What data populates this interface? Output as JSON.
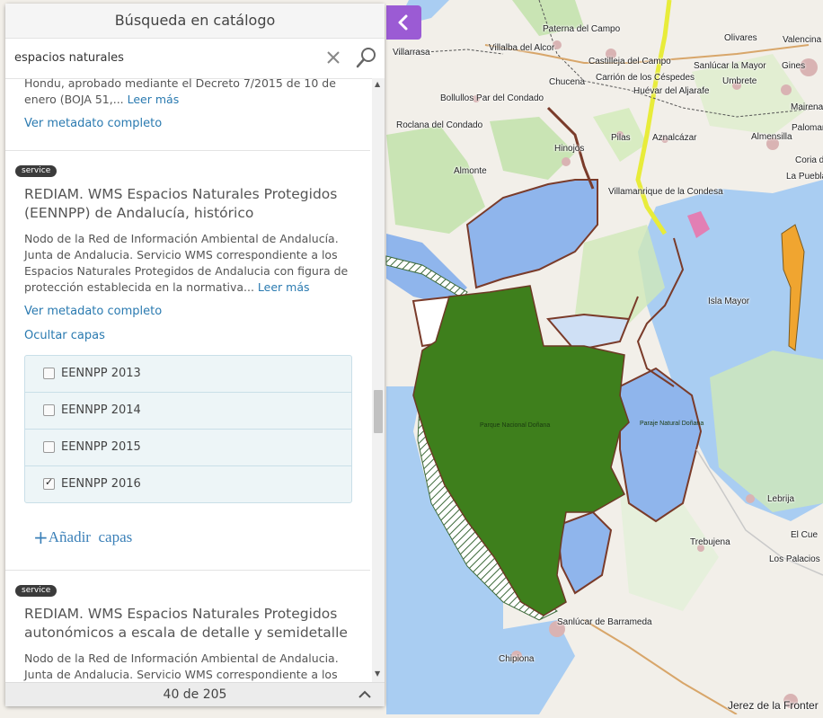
{
  "panel": {
    "title": "Búsqueda en catálogo",
    "search": {
      "value": "espacios naturales",
      "placeholder": ""
    },
    "footer": {
      "count": "40 de 205"
    }
  },
  "results": [
    {
      "partial": true,
      "description_lines": [
        "Hondu, aprobado mediante el Decreto 7/2015 de 10 de",
        "enero (BOJA 51,... "
      ],
      "read_more": "Leer más",
      "metadata_link": "Ver metadato completo"
    },
    {
      "badge": "service",
      "title": "REDIAM. WMS Espacios Naturales Protegidos (EENNPP) de Andalucía, histórico",
      "description": "Nodo de la Red de Información Ambiental de Andalucía. Junta de Andalucia. Servicio WMS correspondiente a los Espacios Naturales Protegidos de Andalucia con figura de protección establecida en la normativa... ",
      "read_more": "Leer más",
      "metadata_link": "Ver metadato completo",
      "hide_layers": "Ocultar capas",
      "layers": [
        {
          "label": "EENNPP 2013",
          "checked": false
        },
        {
          "label": "EENNPP 2014",
          "checked": false
        },
        {
          "label": "EENNPP 2015",
          "checked": false
        },
        {
          "label": "EENNPP 2016",
          "checked": true
        }
      ],
      "add_layers": "Añadir  capas"
    },
    {
      "badge": "service",
      "title": "REDIAM. WMS Espacios Naturales Protegidos autonómicos a escala de detalle y semidetalle",
      "description": "Nodo de la Red de Información Ambiental de Andalucia. Junta de Andalucia. Servicio WMS correspondiente a los Espacios Naturales Protegidos de Andalucia con figura de"
    }
  ],
  "map": {
    "colors": {
      "sea": "#a9cdf2",
      "land": "#f2efe9",
      "protected": "#3e7f1c",
      "marsh": "#90b9ec",
      "accent": "#9b5bd4"
    },
    "places": [
      {
        "name": "Paterna del Campo"
      },
      {
        "name": "Olivares"
      },
      {
        "name": "Valencina"
      },
      {
        "name": "Villarrasa"
      },
      {
        "name": "Villalba del Alcor"
      },
      {
        "name": "Castilleja del Campo"
      },
      {
        "name": "Sanlúcar la Mayor"
      },
      {
        "name": "Gines"
      },
      {
        "name": "Chucena"
      },
      {
        "name": "Carrión de los Céspedes"
      },
      {
        "name": "Umbrete"
      },
      {
        "name": "Huévar del Aljarafe"
      },
      {
        "name": "Bollullos Par del Condado"
      },
      {
        "name": "Mairena"
      },
      {
        "name": "Roclana del Condado"
      },
      {
        "name": "Pilas"
      },
      {
        "name": "Aznalcázar"
      },
      {
        "name": "Almensilla"
      },
      {
        "name": "Palomar"
      },
      {
        "name": "Hinojos"
      },
      {
        "name": "Coria d"
      },
      {
        "name": "Almonte"
      },
      {
        "name": "La Puebla"
      },
      {
        "name": "Villamanrique de la Condesa"
      },
      {
        "name": "Isla Mayor"
      },
      {
        "name": "Parque Nacional Doñana"
      },
      {
        "name": "Paraje Natural Doñana"
      },
      {
        "name": "Lebrija"
      },
      {
        "name": "El Cue"
      },
      {
        "name": "Trebujena"
      },
      {
        "name": "Los Palacios"
      },
      {
        "name": "Sanlúcar de Barrameda"
      },
      {
        "name": "Chipiona"
      },
      {
        "name": "Jerez de la Fronter"
      }
    ]
  }
}
